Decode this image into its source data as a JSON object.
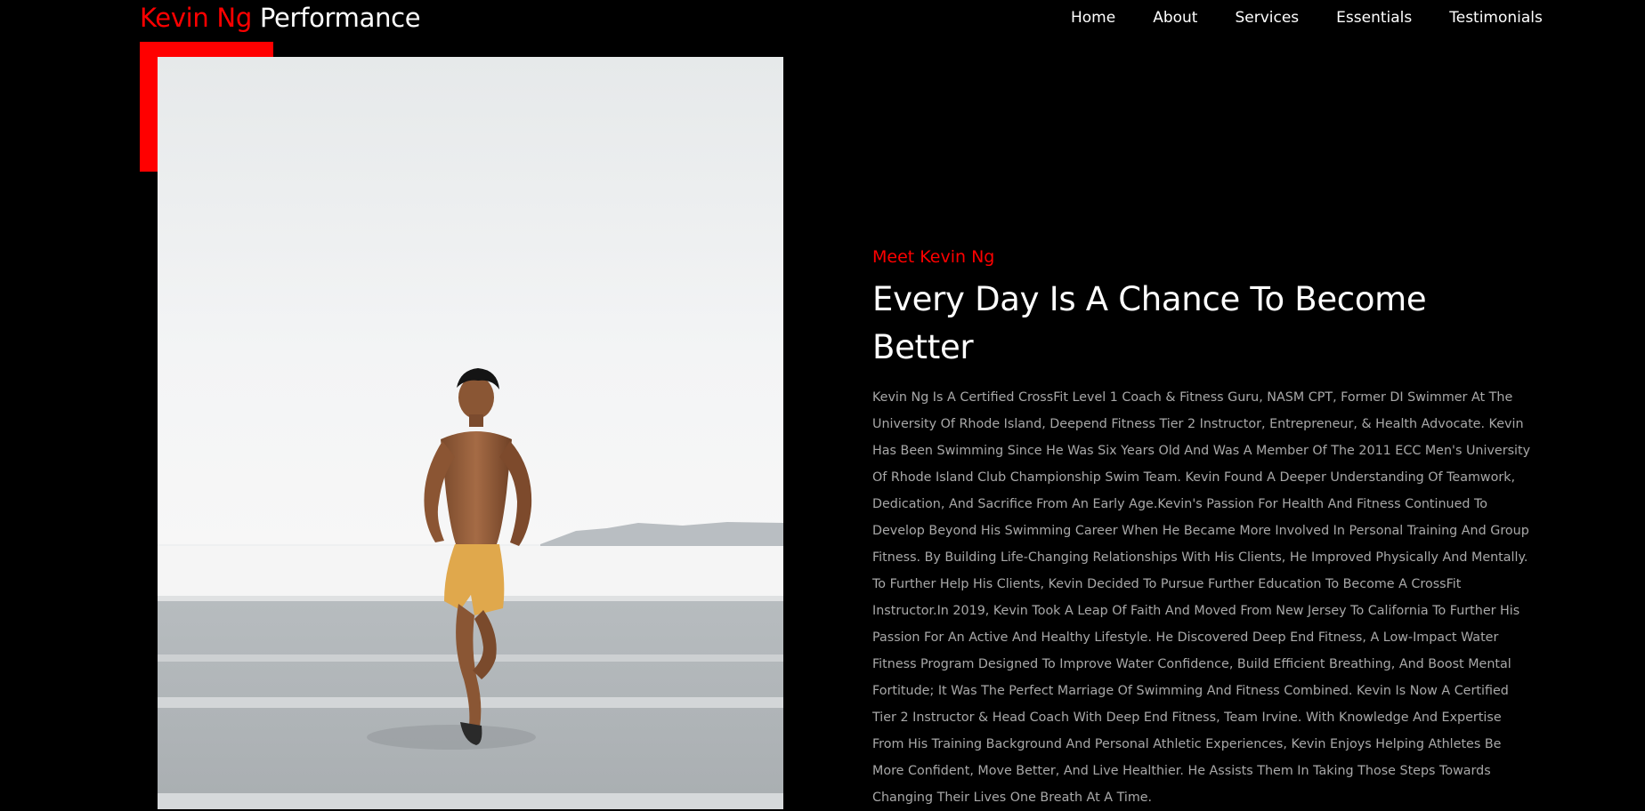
{
  "header": {
    "logo_accent": "Kevin Ng",
    "logo_rest": "Performance",
    "nav": [
      {
        "label": "Home"
      },
      {
        "label": "About"
      },
      {
        "label": "Services"
      },
      {
        "label": "Essentials"
      },
      {
        "label": "Testimonials"
      }
    ]
  },
  "about": {
    "eyebrow": "Meet Kevin Ng",
    "headline": "Every Day Is A Chance To Become Better",
    "bio": "Kevin Ng Is A Certified CrossFit Level 1 Coach & Fitness Guru, NASM CPT, Former DI Swimmer At The University Of Rhode Island, Deepend Fitness Tier 2 Instructor, Entrepreneur, & Health Advocate. Kevin Has Been Swimming Since He Was Six Years Old And Was A Member Of The 2011 ECC Men's University Of Rhode Island Club Championship Swim Team. Kevin Found A Deeper Understanding Of Teamwork, Dedication, And Sacrifice From An Early Age.Kevin's Passion For Health And Fitness Continued To Develop Beyond His Swimming Career When He Became More Involved In Personal Training And Group Fitness. By Building Life-Changing Relationships With His Clients, He Improved Physically And Mentally. To Further Help His Clients, Kevin Decided To Pursue Further Education To Become A CrossFit Instructor.In 2019, Kevin Took A Leap Of Faith And Moved From New Jersey To California To Further His Passion For An Active And Healthy Lifestyle. He Discovered Deep End Fitness, A Low-Impact Water Fitness Program Designed To Improve Water Confidence, Build Efficient Breathing, And Boost Mental Fortitude; It Was The Perfect Marriage Of Swimming And Fitness Combined. Kevin Is Now A Certified Tier 2 Instructor & Head Coach With Deep End Fitness, Team Irvine. With Knowledge And Expertise From His Training Background And Personal Athletic Experiences, Kevin Enjoys Helping Athletes Be More Confident, Move Better, And Live Healthier. He Assists Them In Taking Those Steps Towards Changing Their Lives One Breath At A Time."
  },
  "colors": {
    "background": "#000000",
    "accent": "#ff0000",
    "text": "#ffffff",
    "muted_text": "#a8a8a8"
  }
}
